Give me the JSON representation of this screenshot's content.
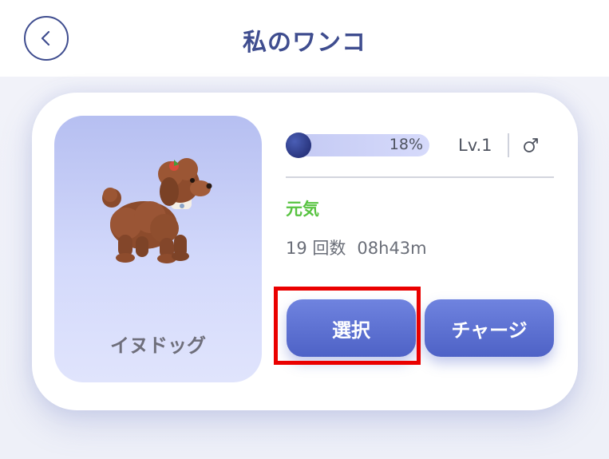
{
  "header": {
    "title": "私のワンコ",
    "back_icon": "chevron-left-icon"
  },
  "pet": {
    "name": "イヌドッグ",
    "image": "poodle-dog-illustration",
    "progress_label": "18%",
    "progress_value": 0.18,
    "level": "Lv.1",
    "gender_icon": "male-gender-icon",
    "status": "元気",
    "stats": {
      "count": "19 回数",
      "time": "08h43m"
    }
  },
  "actions": {
    "select_label": "選択",
    "charge_label": "チャージ"
  },
  "colors": {
    "accent": "#3f4d8f",
    "button": "#5b6fd3",
    "status_green": "#58c341",
    "highlight": "#ea0000"
  }
}
